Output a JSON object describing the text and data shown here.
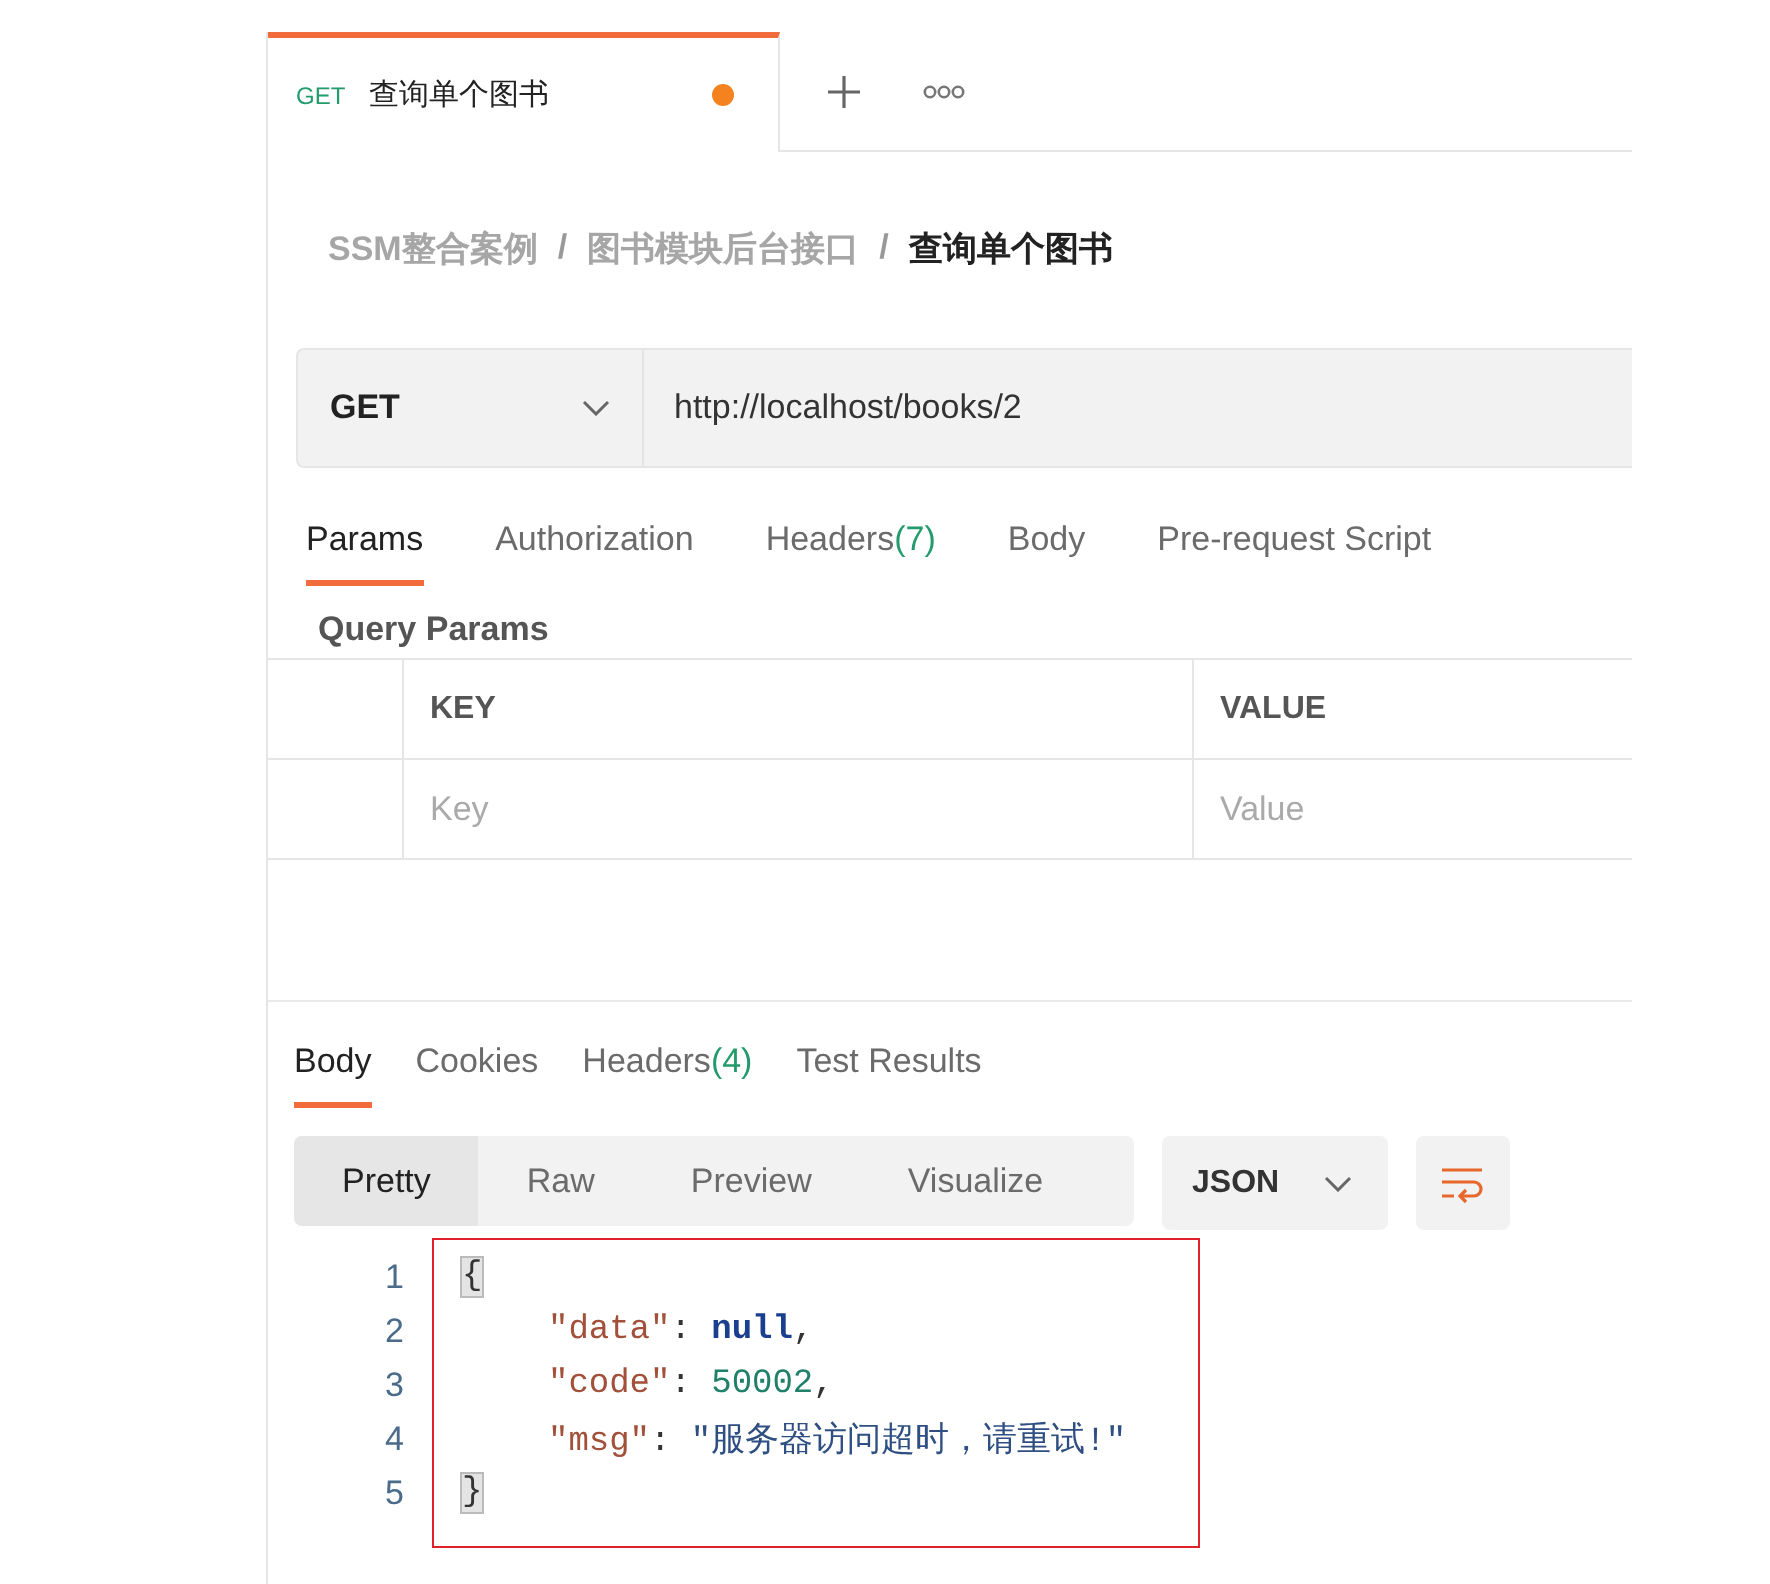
{
  "tab": {
    "method": "GET",
    "title": "查询单个图书",
    "unsaved": true
  },
  "breadcrumb": [
    {
      "label": "SSM整合案例",
      "current": false
    },
    {
      "separator": "/",
      "label": "图书模块后台接口",
      "current": false
    },
    {
      "separator": "/",
      "label": "查询单个图书",
      "current": true
    }
  ],
  "request": {
    "method": "GET",
    "url": "http://localhost/books/2"
  },
  "request_tabs": [
    {
      "label": "Params",
      "selected": true
    },
    {
      "label": "Authorization",
      "selected": false
    },
    {
      "label": "Headers",
      "count": "(7)",
      "selected": false
    },
    {
      "label": "Body",
      "selected": false
    },
    {
      "label": "Pre-request Script",
      "selected": false
    }
  ],
  "query_params": {
    "title": "Query Params",
    "columns": [
      {
        "label": "KEY",
        "placeholder": "Key"
      },
      {
        "label": "VALUE",
        "placeholder": "Value"
      }
    ]
  },
  "response_tabs": [
    {
      "label": "Body",
      "selected": true
    },
    {
      "label": "Cookies",
      "selected": false
    },
    {
      "label": "Headers",
      "count": "(4)",
      "selected": false
    },
    {
      "label": "Test Results",
      "selected": false
    }
  ],
  "view_modes": [
    {
      "label": "Pretty",
      "selected": true
    },
    {
      "label": "Raw",
      "selected": false
    },
    {
      "label": "Preview",
      "selected": false
    },
    {
      "label": "Visualize",
      "selected": false
    }
  ],
  "format": "JSON",
  "code": {
    "highlighted": true,
    "lines": [
      {
        "number": "1",
        "tokens": [
          {
            "text": "{",
            "kind": "brace"
          }
        ],
        "children": [
          {
            "number": "2",
            "tokens": [
              {
                "text": "\"data\"",
                "kind": "key"
              },
              {
                "text": ": ",
                "kind": "punct"
              },
              {
                "text": "null",
                "kind": "null"
              },
              {
                "text": ",",
                "kind": "punct"
              }
            ]
          },
          {
            "number": "3",
            "tokens": [
              {
                "text": "\"code\"",
                "kind": "key"
              },
              {
                "text": ": ",
                "kind": "punct"
              },
              {
                "text": "50002",
                "kind": "number"
              },
              {
                "text": ",",
                "kind": "punct"
              }
            ]
          },
          {
            "number": "4",
            "tokens": [
              {
                "text": "\"msg\"",
                "kind": "key"
              },
              {
                "text": ": ",
                "kind": "punct"
              },
              {
                "text": "\"服务器访问超时，请重试!\"",
                "kind": "string"
              }
            ]
          }
        ]
      },
      {
        "number": "5",
        "tokens": [
          {
            "text": "}",
            "kind": "brace"
          }
        ]
      }
    ]
  }
}
